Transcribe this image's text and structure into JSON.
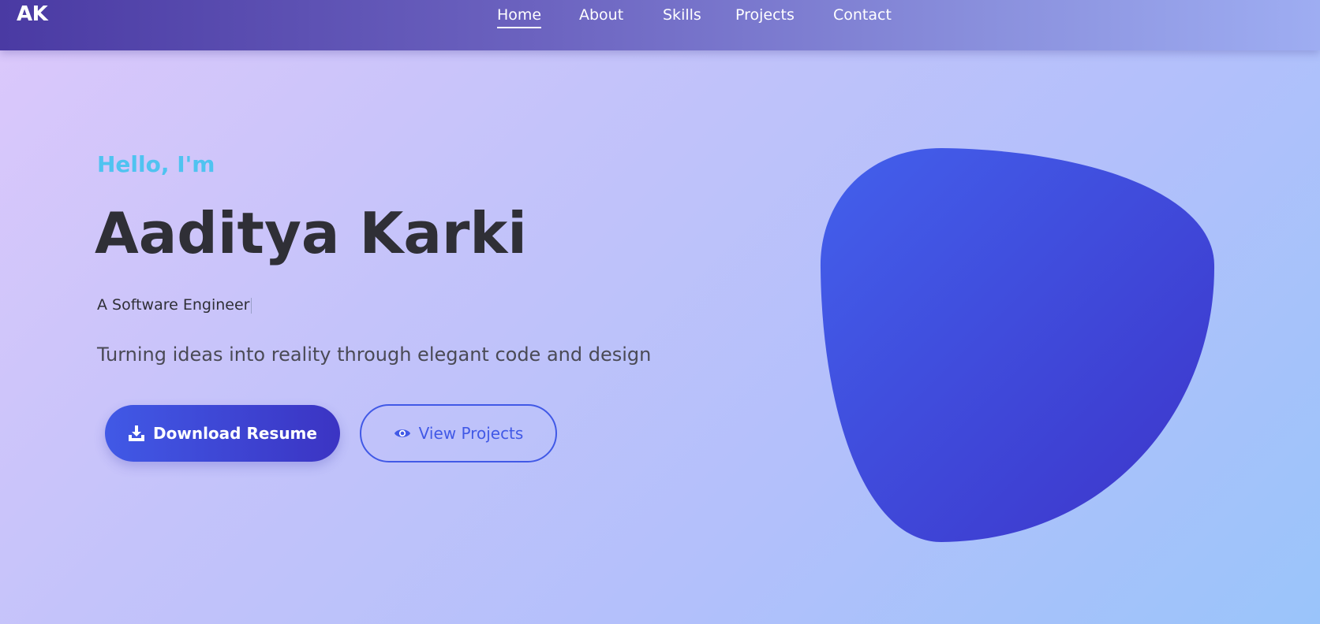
{
  "nav": {
    "brand": "AK",
    "items": [
      {
        "label": "Home",
        "active": true
      },
      {
        "label": "About",
        "active": false
      },
      {
        "label": "Skills",
        "active": false
      },
      {
        "label": "Projects",
        "active": false
      },
      {
        "label": "Contact",
        "active": false
      }
    ]
  },
  "hero": {
    "greeting": "Hello, I'm",
    "name": "Aaditya Karki",
    "role": "A Software Engineer",
    "tagline": "Turning ideas into reality through elegant code and design",
    "primary_button": {
      "label": "Download Resume",
      "icon": "download-icon"
    },
    "secondary_button": {
      "label": "View Projects",
      "icon": "eye-icon"
    }
  },
  "colors": {
    "accent": "#4159e6",
    "accent_dark": "#3b34c3",
    "greeting": "#4fc3f0",
    "heading": "#2f2f36"
  }
}
